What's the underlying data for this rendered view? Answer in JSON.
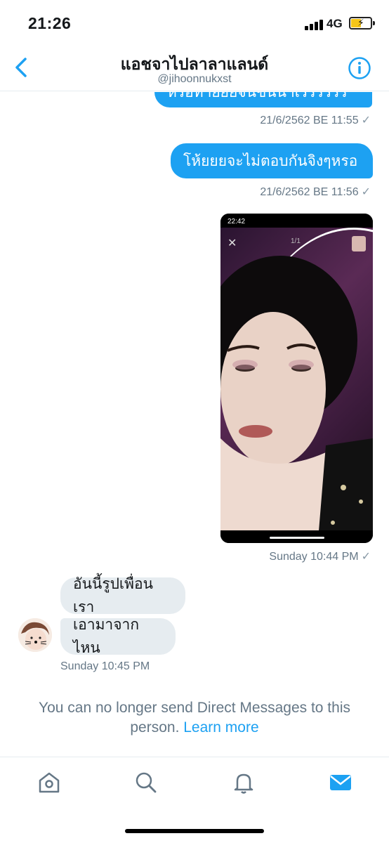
{
  "status_bar": {
    "time": "21:26",
    "network": "4G"
  },
  "header": {
    "title": "แอชจาไปลาลาแลนด์",
    "handle": "@jihoonnukxst"
  },
  "messages": {
    "partial_text": "หรือทำยยยจนขนนาเรรรรรร",
    "ts1": "21/6/2562 BE 11:55",
    "msg2": "โห้ยยยจะไม่ตอบกันจิงๆหรอ",
    "ts2": "21/6/2562 BE 11:56",
    "photo": {
      "status_time": "22:42",
      "counter": "1/1"
    },
    "ts3": "Sunday 10:44 PM",
    "in1": "อันนี้รูปเพื่อนเรา",
    "in2": "เอามาจากไหน",
    "ts4": "Sunday 10:45 PM",
    "check": "✓"
  },
  "notice": {
    "text": "You can no longer send Direct Messages to this person.",
    "link": "Learn more"
  },
  "tabbar": {
    "items": [
      "home-icon",
      "search-icon",
      "notifications-icon",
      "messages-icon"
    ]
  },
  "colors": {
    "accent": "#1da1f2",
    "incoming_bubble": "#e6ecf0",
    "muted": "#657786"
  }
}
